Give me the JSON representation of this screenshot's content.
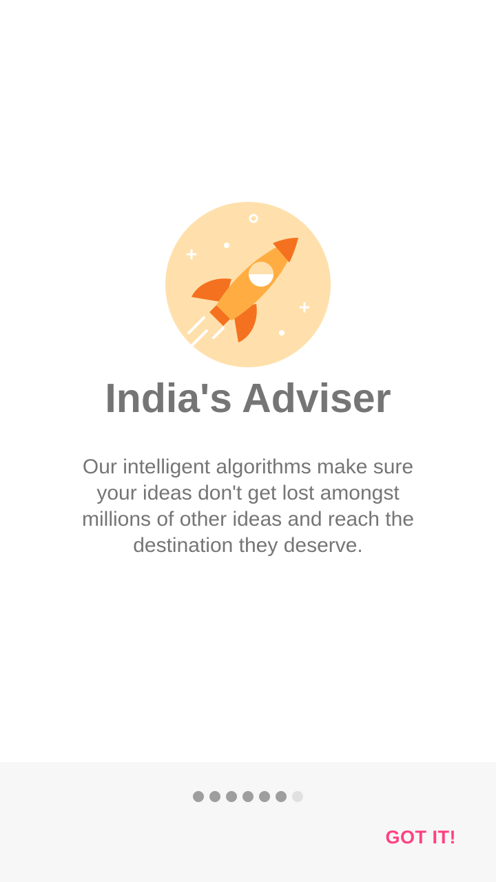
{
  "onboarding": {
    "illustration_icon": "rocket-icon",
    "title": "India's Adviser",
    "description": "Our intelligent algorithms make sure your ideas don't get lost amongst millions of other ideas and reach the destination they deserve.",
    "page_indicator": {
      "total_pages": 7,
      "active_pages": 6
    },
    "got_it_label": "GOT IT!"
  },
  "colors": {
    "accent": "#ff4081",
    "text": "#757575",
    "circle_bg": "#ffe0ac",
    "rocket_body": "#ffad42",
    "rocket_fin": "#f4711f",
    "dot_active": "#9e9e9e",
    "dot_inactive": "#e0e0e0",
    "bottom_bar": "#f7f7f7"
  }
}
